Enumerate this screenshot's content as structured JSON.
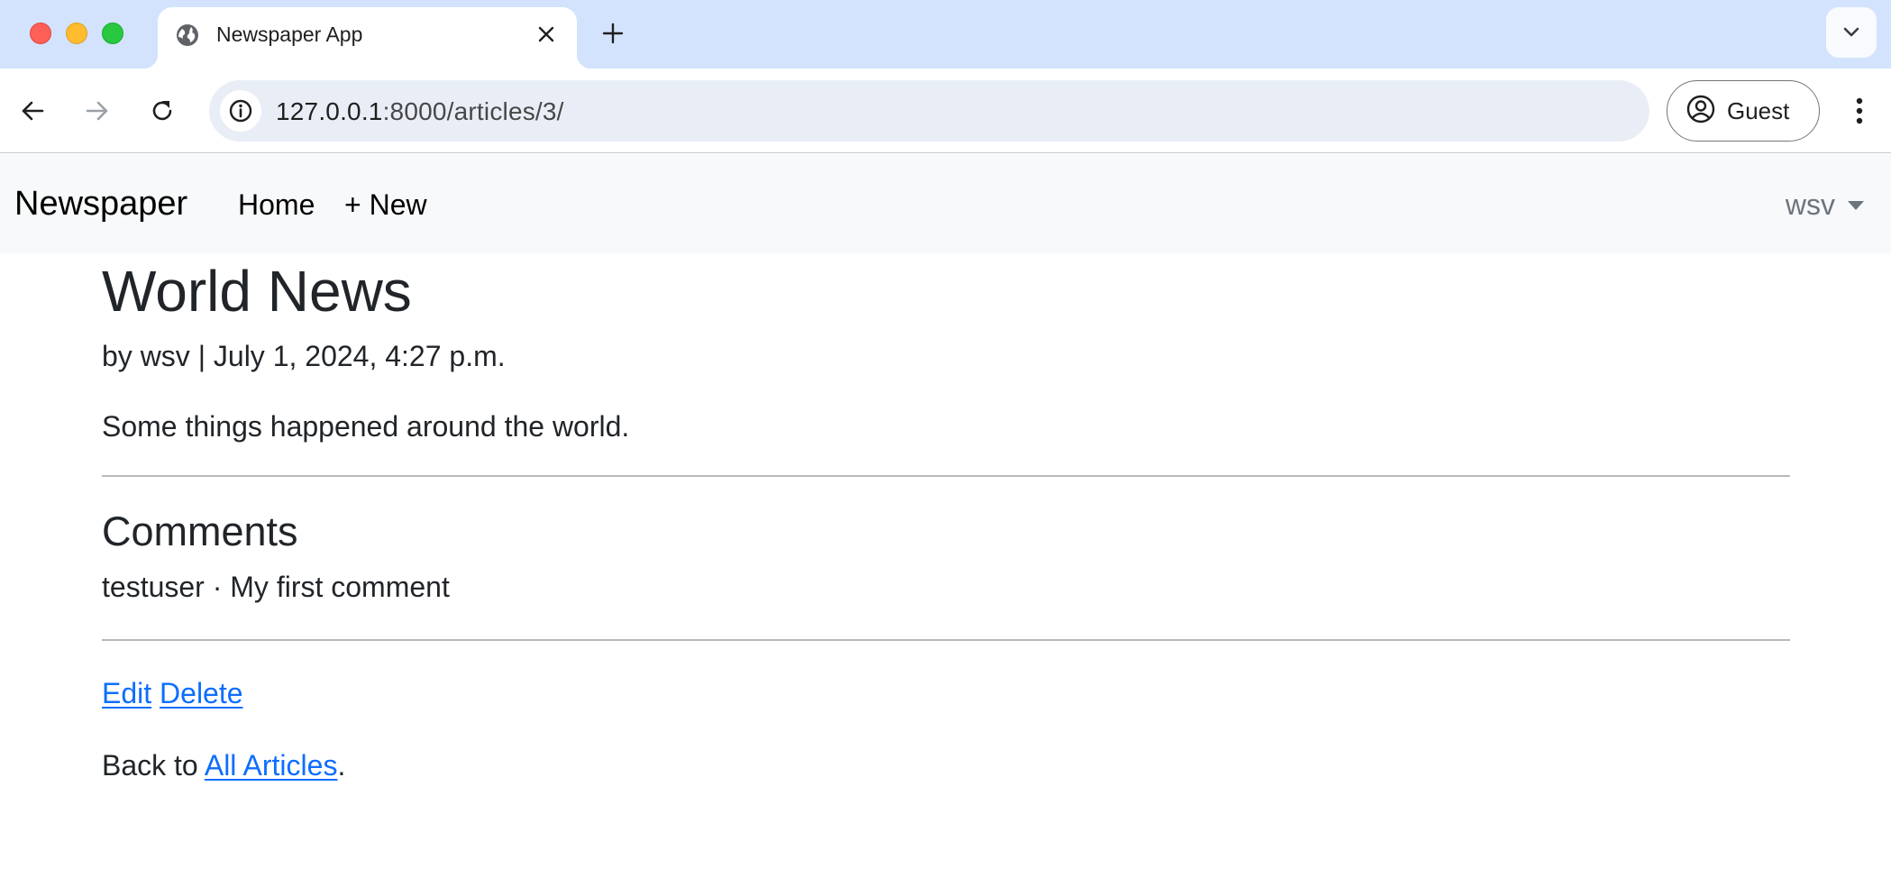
{
  "browser": {
    "tab_title": "Newspaper App",
    "url_host": "127.0.0.1",
    "url_path": ":8000/articles/3/",
    "profile_label": "Guest"
  },
  "navbar": {
    "brand": "Newspaper",
    "links": [
      "Home",
      "+ New"
    ],
    "user": "wsv"
  },
  "article": {
    "title": "World News",
    "byline": "by wsv | July 1, 2024, 4:27 p.m.",
    "body": "Some things happened around the world."
  },
  "comments": {
    "heading": "Comments",
    "items": [
      {
        "text": "testuser · My first comment"
      }
    ]
  },
  "actions": {
    "edit": "Edit",
    "delete": "Delete"
  },
  "back": {
    "prefix": "Back to ",
    "link": "All Articles",
    "suffix": "."
  },
  "colors": {
    "tabstrip": "#d3e3fd",
    "navbar_bg": "#f8f9fa",
    "link": "#0d6efd",
    "muted": "#6c757d"
  }
}
